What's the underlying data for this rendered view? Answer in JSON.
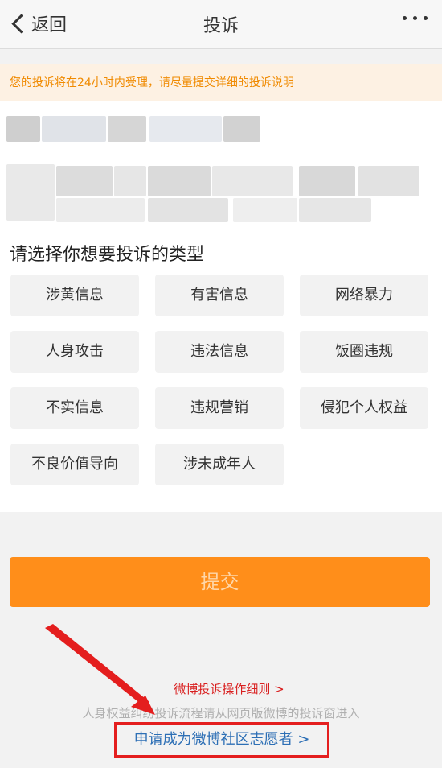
{
  "nav": {
    "back_label": "返回",
    "title": "投诉",
    "more_icon": "more-dots-icon"
  },
  "notice": "您的投诉将在24小时内受理，请尽量提交详细的投诉说明",
  "section_title": "请选择你想要投诉的类型",
  "types": [
    "涉黄信息",
    "有害信息",
    "网络暴力",
    "人身攻击",
    "违法信息",
    "饭圈违规",
    "不实信息",
    "违规营销",
    "侵犯个人权益",
    "不良价值导向",
    "涉未成年人"
  ],
  "submit_label": "提交",
  "footer": {
    "rules_link": "微博投诉操作细则 >",
    "hint": "人身权益纠纷投诉流程请从网页版微博的投诉窗进入",
    "volunteer_link": "申请成为微博社区志愿者 >"
  },
  "colors": {
    "accent_orange": "#ff8e1a",
    "notice_text": "#f08a00",
    "annotation_red": "#e41e1e",
    "link_blue": "#2d6fb5"
  }
}
